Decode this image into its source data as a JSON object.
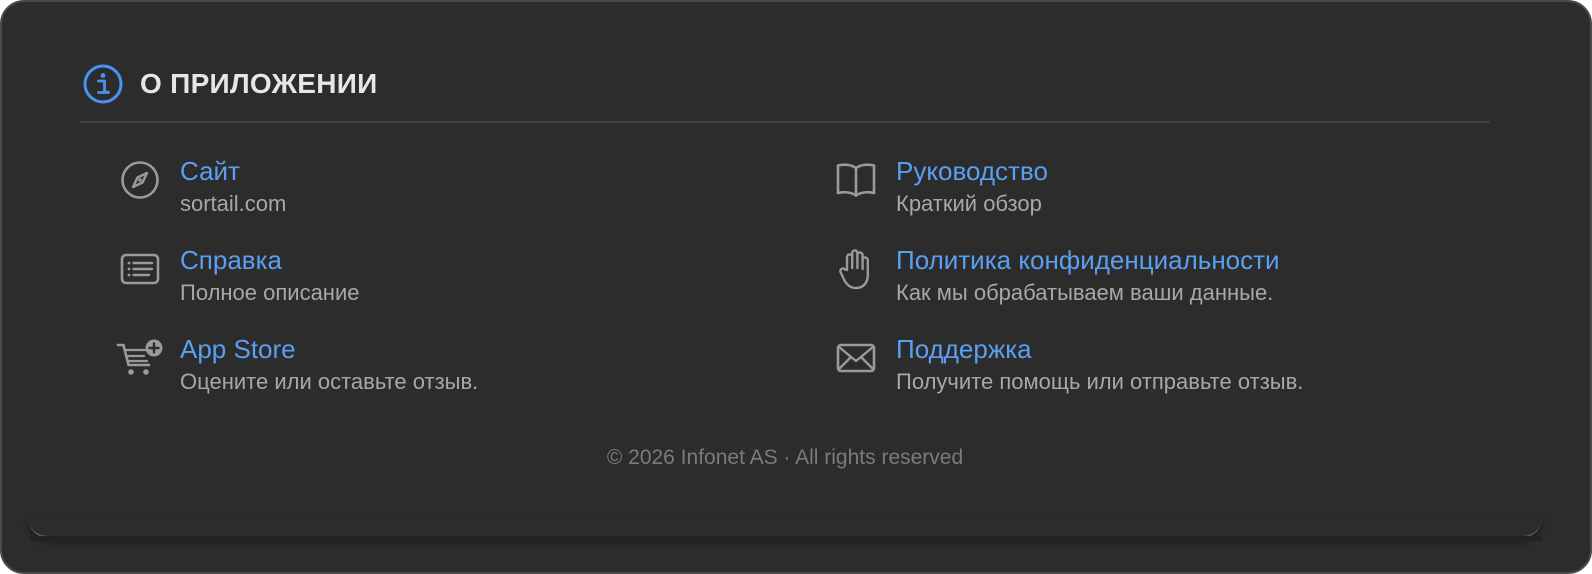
{
  "colors": {
    "background": "#2c2c2c",
    "accent": "#5a9ff2",
    "title": "#e6e6e6",
    "subtitle": "#a8a8a8",
    "footer": "#7b7b7b",
    "icon": "#9a9a9a"
  },
  "header": {
    "icon": "info-icon",
    "title": "О ПРИЛОЖЕНИИ"
  },
  "items": [
    {
      "icon": "compass-icon",
      "label": "Сайт",
      "subtitle": "sortail.com"
    },
    {
      "icon": "book-icon",
      "label": "Руководство",
      "subtitle": "Краткий обзор"
    },
    {
      "icon": "text-document-icon",
      "label": "Справка",
      "subtitle": "Полное описание"
    },
    {
      "icon": "raised-hand-icon",
      "label": "Политика конфиденциальности",
      "subtitle": "Как мы обрабатываем ваши данные."
    },
    {
      "icon": "cart-plus-icon",
      "label": "App Store",
      "subtitle": "Оцените или оставьте отзыв."
    },
    {
      "icon": "envelope-icon",
      "label": "Поддержка",
      "subtitle": "Получите помощь или отправьте отзыв."
    }
  ],
  "footer": {
    "copyright": "© 2026 Infonet AS · All rights reserved"
  }
}
